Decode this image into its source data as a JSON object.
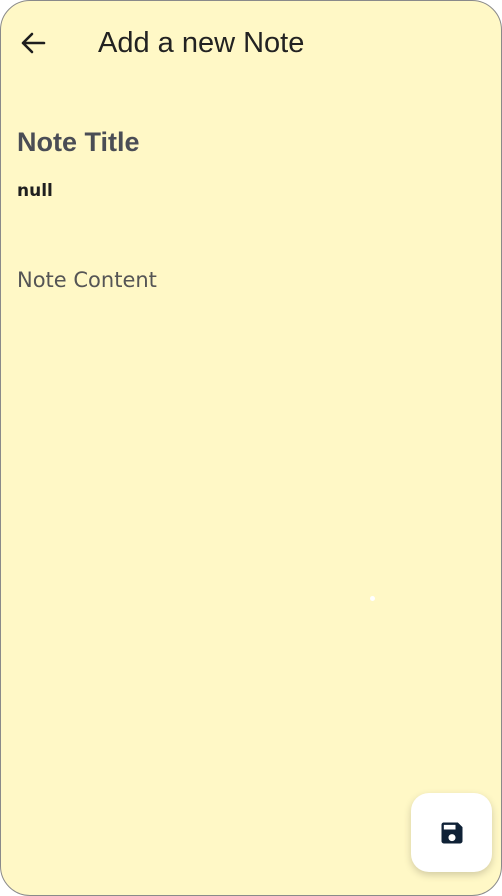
{
  "app_bar": {
    "title": "Add a new Note",
    "back_icon": "arrow-back-icon"
  },
  "form": {
    "title_placeholder": "Note Title",
    "title_value_text": "null",
    "content_placeholder": "Note Content"
  },
  "fab": {
    "icon": "save-icon"
  },
  "colors": {
    "background": "#fff8c6",
    "text_primary": "#222222",
    "title_placeholder": "#4a4d55",
    "fab_background": "#ffffff",
    "icon_color": "#0f2136"
  }
}
